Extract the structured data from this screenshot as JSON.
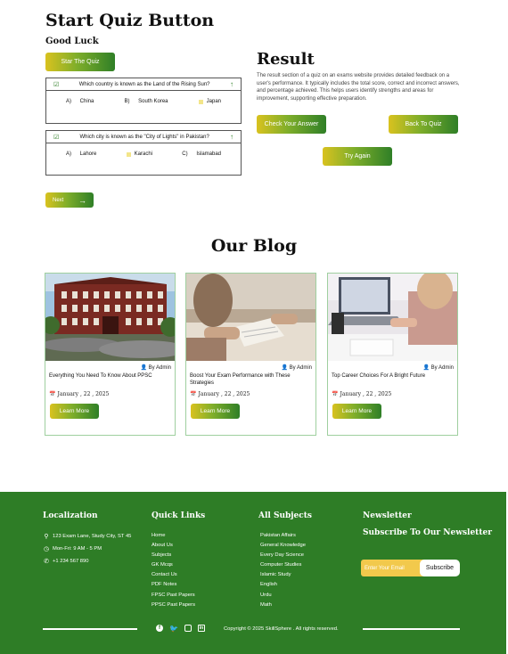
{
  "quiz": {
    "title": "Start Quiz Button",
    "subtitle": "Good Luck",
    "start_label": "Star The Quiz",
    "questions": [
      {
        "text": "Which country is known as the Land of the Rising Sun?",
        "options": [
          {
            "key": "A)",
            "label": "China"
          },
          {
            "key": "B)",
            "label": "South Korea"
          },
          {
            "key": "",
            "label": "Japan"
          }
        ]
      },
      {
        "text": "Which city is known as the \"City of Lights\" in Pakistan?",
        "options": [
          {
            "key": "A)",
            "label": "Lahore"
          },
          {
            "key": "",
            "label": "Karachi"
          },
          {
            "key": "C)",
            "label": "Islamabad"
          }
        ]
      }
    ],
    "next_label": "Next"
  },
  "result": {
    "title": "Result",
    "text": "The result section of a quiz on an exams website provides detailed feedback on a user's performance. It typically includes the total score, correct and incorrect answers, and percentage achieved. This helps users identify strengths and areas for improvement, supporting effective preparation.",
    "check_label": "Check Your Answer",
    "back_label": "Back To Quiz",
    "retry_label": "Try Again"
  },
  "blog": {
    "title": "Our Blog",
    "cards": [
      {
        "author": "By Admin",
        "title": "Everything You Need To Know About PPSC",
        "date": "January , 22 , 2025",
        "button": "Learn More"
      },
      {
        "author": "By Admin",
        "title": "Boost Your Exam Performance with These Strategies",
        "date": "January , 22 , 2025",
        "button": "Learn More"
      },
      {
        "author": "By Admin",
        "title": "Top Career Choices For A Bright Future",
        "date": "January , 22 , 2025",
        "button": "Learn More"
      }
    ]
  },
  "footer": {
    "localization": {
      "title": "Localization",
      "address": "123 Exam Lane, Study City, ST 45",
      "hours": "Mon-Fri: 9 AM - 5 PM",
      "phone": "+1 234 567 890"
    },
    "quick_links": {
      "title": "Quick Links",
      "items": [
        "Home",
        "About Us",
        "Subjects",
        "GK Mcqs",
        "Contact Us",
        "PDF Notes",
        "FPSC Past Papers",
        "PPSC Past Papers"
      ]
    },
    "subjects": {
      "title": "All Subjects",
      "items": [
        "Pakistan Affairs",
        "General Knowledge",
        "Every Day Science",
        "Computer Studies",
        "Islamic Study",
        "English",
        "Urdu",
        "Math"
      ]
    },
    "newsletter": {
      "title": "Newsletter",
      "subtitle": "Subscribe To Our Newsletter",
      "placeholder": "Enter Your Email",
      "button": "Subscribe"
    },
    "copyright": "Copyright © 2025 SkillSphere .  All rights reserved."
  },
  "colors": {
    "green": "#2e7d26",
    "yellow": "#d9c21f",
    "card_border": "#9fcf9f"
  },
  "icons": [
    "check-icon",
    "arrow-up-icon",
    "arrow-right-icon",
    "user-icon",
    "calendar-icon",
    "map-pin-icon",
    "clock-icon",
    "phone-icon",
    "facebook-icon",
    "twitter-icon",
    "instagram-icon",
    "linkedin-icon"
  ]
}
